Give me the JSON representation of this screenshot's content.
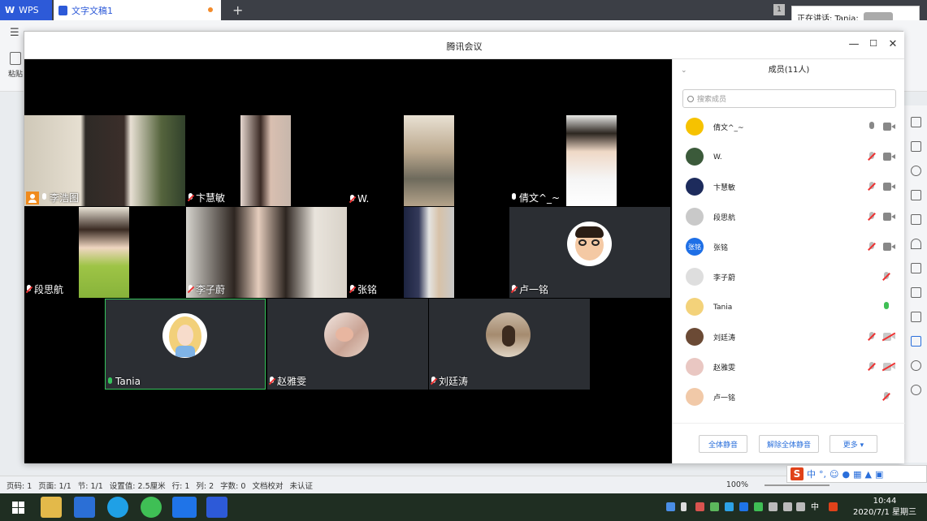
{
  "wps": {
    "tabs": [
      {
        "label": "WPS"
      },
      {
        "label": "文字文稿1"
      }
    ],
    "new_tab": "+",
    "tab_count": "1",
    "speaking": "正在讲话: Tania;",
    "paste_label": "粘贴"
  },
  "meeting": {
    "title": "腾讯会议",
    "controls": {
      "minimize": "—",
      "maximize": "☐",
      "close": "✕"
    },
    "tiles": [
      {
        "name": "李浩图"
      },
      {
        "name": "卞慧敏"
      },
      {
        "name": "W."
      },
      {
        "name": "倩文^_~"
      },
      {
        "name": "段思航"
      },
      {
        "name": "李子蔚"
      },
      {
        "name": "张铭"
      },
      {
        "name": "卢一铭"
      },
      {
        "name": "Tania"
      },
      {
        "name": "赵雅雯"
      },
      {
        "name": "刘廷涛"
      }
    ],
    "panel": {
      "title": "成员(11人)",
      "search_placeholder": "搜索成员",
      "members": [
        {
          "name": "倩文^_~",
          "avatar": "#f6c200",
          "mic": "on",
          "cam": "on"
        },
        {
          "name": "W.",
          "avatar": "#3b5a3a",
          "mic": "off",
          "cam": "on"
        },
        {
          "name": "卞慧敏",
          "avatar": "#1d2b5c",
          "mic": "off",
          "cam": "on"
        },
        {
          "name": "段思航",
          "avatar": "#c9c9c9",
          "mic": "off",
          "cam": "on"
        },
        {
          "name": "张铭",
          "avatar": "#1e6fe6",
          "avatar_text": "张铭",
          "mic": "off",
          "cam": "on"
        },
        {
          "name": "李子蔚",
          "avatar": "#dedede",
          "mic": "off",
          "cam": "none"
        },
        {
          "name": "Tania",
          "avatar": "#f3d27a",
          "mic": "green",
          "cam": "none"
        },
        {
          "name": "刘廷涛",
          "avatar": "#6b4a35",
          "mic": "off",
          "cam": "off"
        },
        {
          "name": "赵雅雯",
          "avatar": "#e9c7c2",
          "mic": "off",
          "cam": "off"
        },
        {
          "name": "卢一铭",
          "avatar": "#f1c9a8",
          "mic": "off",
          "cam": "none"
        }
      ],
      "buttons": {
        "mute_all": "全体静音",
        "unmute_all": "解除全体静音",
        "more": "更多 ▾"
      }
    }
  },
  "statusbar": {
    "page_code": "页码: 1",
    "page": "页面: 1/1",
    "section": "节: 1/1",
    "setting": "设置值: 2.5厘米",
    "row": "行: 1",
    "col": "列: 2",
    "words": "字数: 0",
    "proof": "文档校对",
    "cert": "未认证",
    "zoom": "100%"
  },
  "ime": {
    "logo": "S",
    "mode": "中"
  },
  "taskbar": {
    "time": "10:44",
    "date": "2020/7/1 星期三",
    "lang": "中"
  },
  "colors": {
    "accent": "#2a6fdb",
    "speaker_border": "#35c35c",
    "host": "#f08a1c"
  }
}
